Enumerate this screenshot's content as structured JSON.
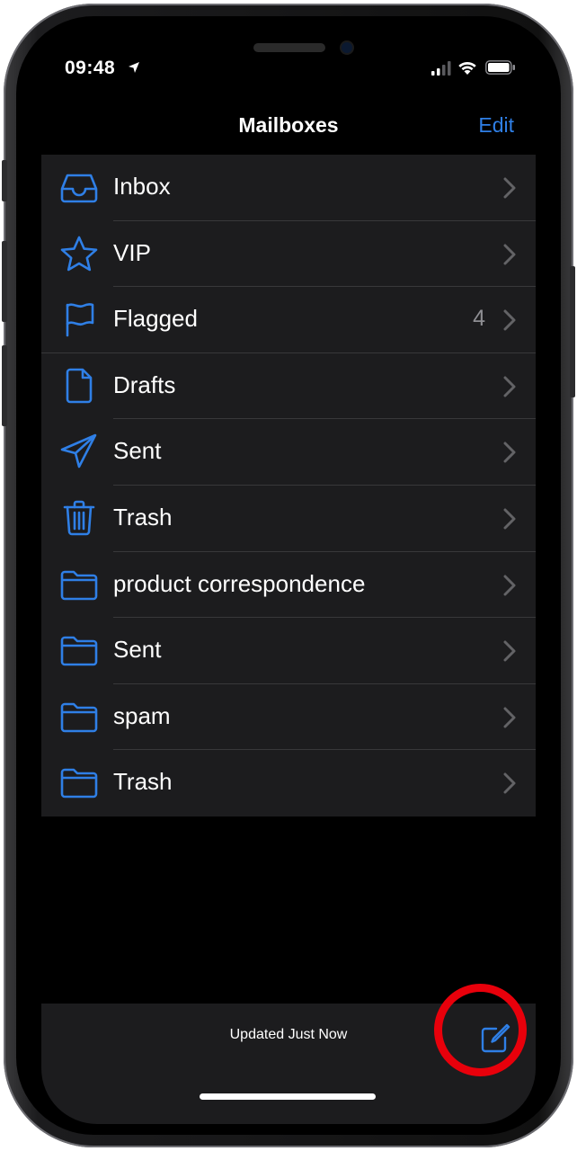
{
  "status_bar": {
    "time": "09:48",
    "icons": [
      "location-arrow-icon",
      "cellular-signal-icon",
      "wifi-icon",
      "battery-icon"
    ]
  },
  "nav": {
    "title": "Mailboxes",
    "edit_label": "Edit"
  },
  "mailboxes": [
    {
      "label": "Inbox",
      "icon": "inbox-tray-icon",
      "count": ""
    },
    {
      "label": "VIP",
      "icon": "star-icon",
      "count": ""
    },
    {
      "label": "Flagged",
      "icon": "flag-icon",
      "count": "4"
    },
    {
      "label": "Drafts",
      "icon": "document-icon",
      "count": ""
    },
    {
      "label": "Sent",
      "icon": "paper-plane-icon",
      "count": ""
    },
    {
      "label": "Trash",
      "icon": "trash-icon",
      "count": ""
    },
    {
      "label": "product correspondence",
      "icon": "folder-icon",
      "count": ""
    },
    {
      "label": "Sent",
      "icon": "folder-icon",
      "count": ""
    },
    {
      "label": "spam",
      "icon": "folder-icon",
      "count": ""
    },
    {
      "label": "Trash",
      "icon": "folder-icon",
      "count": ""
    }
  ],
  "toolbar": {
    "status_text": "Updated Just Now",
    "compose_icon": "compose-icon"
  },
  "colors": {
    "accent": "#2f7fe6",
    "row_bg": "#1c1c1e",
    "highlight_ring": "#e8000b"
  }
}
